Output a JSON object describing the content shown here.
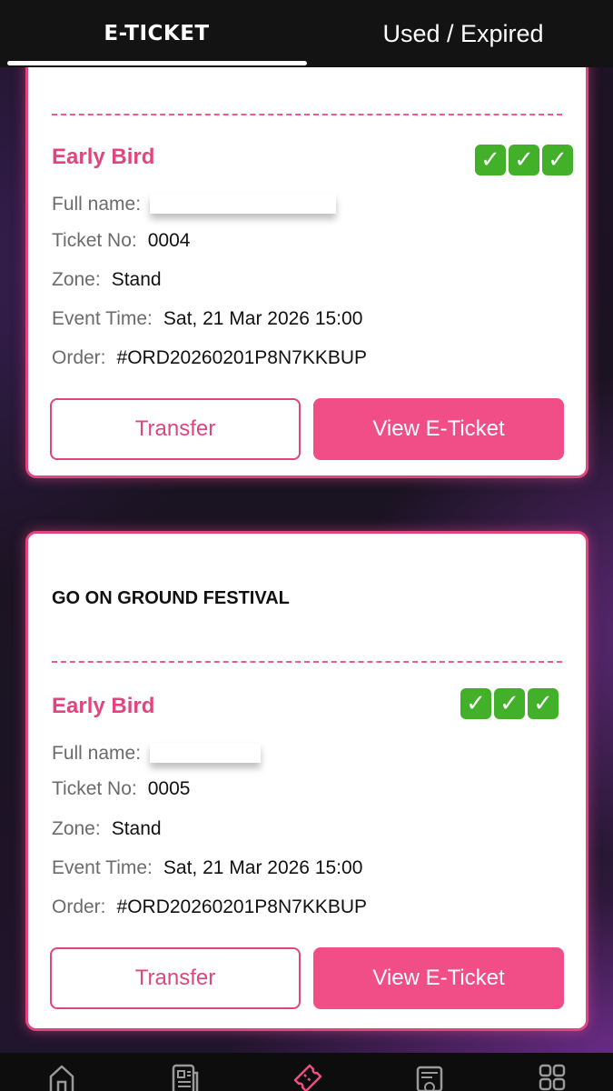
{
  "tabs": {
    "eticket": "E-TICKET",
    "used_expired": "Used / Expired"
  },
  "tickets": [
    {
      "event_title": "",
      "tier": "Early Bird",
      "checks": "✓✓✓",
      "full_name_label": "Full name:",
      "ticket_no_label": "Ticket No:",
      "ticket_no": "0004",
      "zone_label": "Zone:",
      "zone": "Stand",
      "event_time_label": "Event Time:",
      "event_time": "Sat, 21 Mar 2026 15:00",
      "order_label": "Order:",
      "order": "#ORD20260201P8N7KKBUP",
      "transfer_label": "Transfer",
      "view_label": "View E-Ticket"
    },
    {
      "event_title": "GO ON GROUND FESTIVAL",
      "tier": "Early Bird",
      "checks": "✓✓✓",
      "full_name_label": "Full name:",
      "ticket_no_label": "Ticket No:",
      "ticket_no": "0005",
      "zone_label": "Zone:",
      "zone": "Stand",
      "event_time_label": "Event Time:",
      "event_time": "Sat, 21 Mar 2026 15:00",
      "order_label": "Order:",
      "order": "#ORD20260201P8N7KKBUP",
      "transfer_label": "Transfer",
      "view_label": "View E-Ticket"
    }
  ],
  "bottom_nav": {
    "icons": [
      "home-icon",
      "news-icon",
      "ticket-icon",
      "voucher-icon",
      "menu-grid-icon"
    ],
    "active_color": "#f14d87",
    "inactive_color": "#9a9a9a"
  },
  "colors": {
    "accent": "#e0457e",
    "button": "#f14d87",
    "check": "#43b02a"
  }
}
